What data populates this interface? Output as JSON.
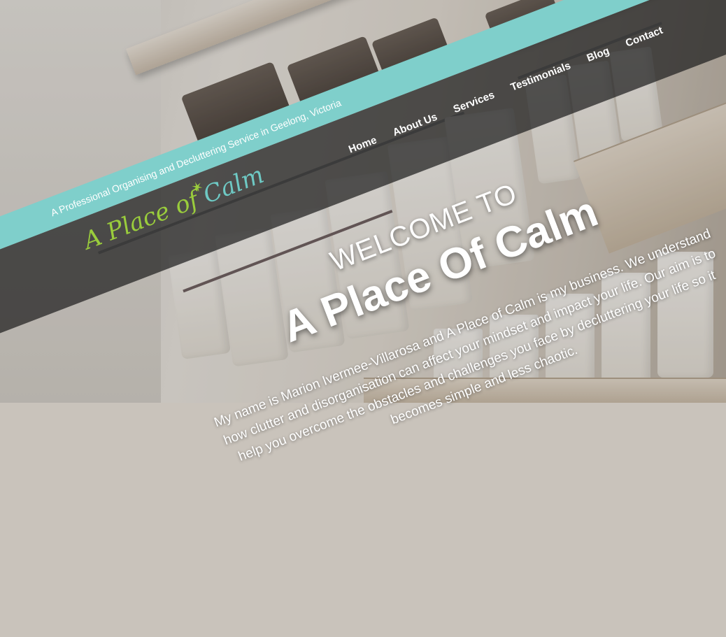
{
  "site": {
    "tagline": "A Professional Organising and Decluttering Service in Geelong, Victoria",
    "logo": {
      "part1": "A Place of ",
      "part2": "Calm"
    }
  },
  "nav": {
    "items": [
      {
        "label": "Home"
      },
      {
        "label": "About Us"
      },
      {
        "label": "Services"
      },
      {
        "label": "Testimonials"
      },
      {
        "label": "Blog"
      },
      {
        "label": "Contact"
      }
    ]
  },
  "hero": {
    "welcome": "WELCOME TO",
    "title": "A Place Of Calm",
    "intro": "My name is Marion Ivermee-Villarosa and A Place of Calm is my business. We understand how clutter and disorganisation can affect your mindset and impact your life. Our aim is to help you overcome the obstacles and challenges you face by decluttering your life so it becomes simple and less chaotic."
  },
  "colors": {
    "tagline_bar": "#7fcfcb",
    "header_bar": "#1e1e1e",
    "logo_green": "#9acd3c",
    "logo_teal": "#6ec9c4"
  }
}
